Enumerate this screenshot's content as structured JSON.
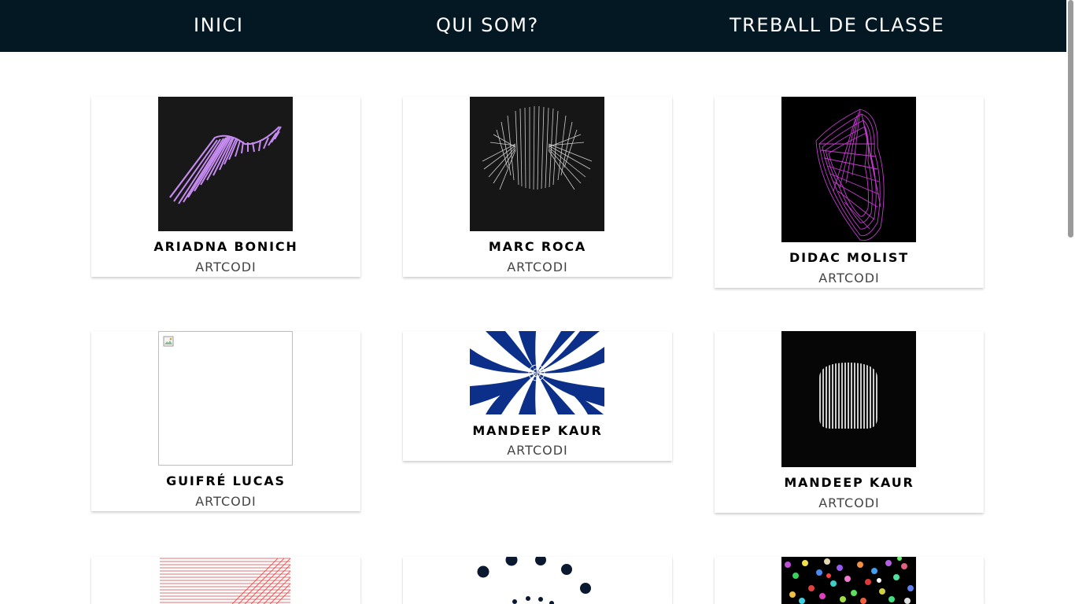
{
  "nav": {
    "home": "INICI",
    "about": "QUI SOM?",
    "classwork": "TREBALL DE CLASSE"
  },
  "cards": [
    {
      "name": "ARIADNA BONICH",
      "subtitle": "ARTCODI"
    },
    {
      "name": "MARC ROCA",
      "subtitle": "ARTCODI"
    },
    {
      "name": "DIDAC MOLIST",
      "subtitle": "ARTCODI"
    },
    {
      "name": "GUIFRÉ LUCAS",
      "subtitle": "ARTCODI"
    },
    {
      "name": "MANDEEP KAUR",
      "subtitle": "ARTCODI"
    },
    {
      "name": "MANDEEP KAUR",
      "subtitle": "ARTCODI"
    }
  ],
  "colors": {
    "navbar": "#041824",
    "accent_purple": "#c58bf0",
    "accent_magenta": "#d13fdc",
    "accent_blue": "#0c2f8a"
  }
}
